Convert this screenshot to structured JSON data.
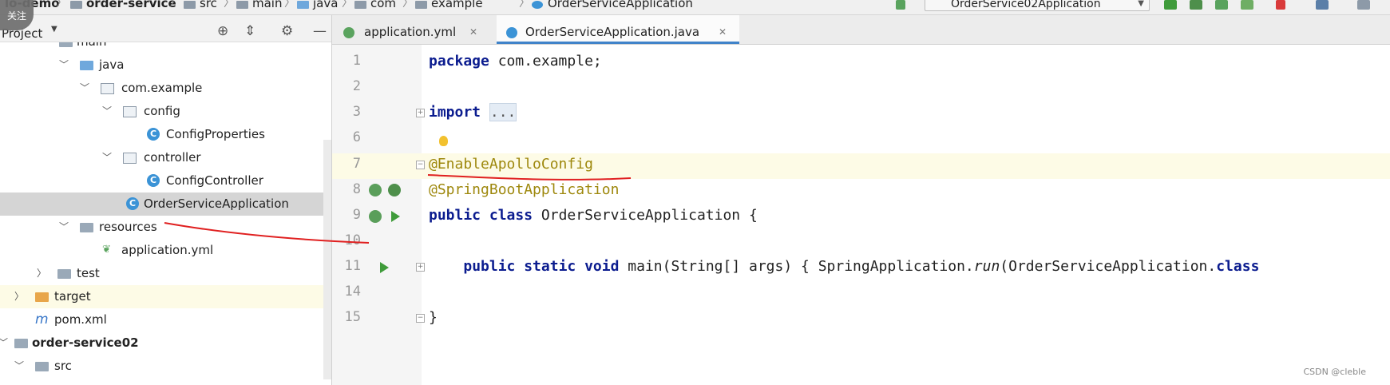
{
  "breadcrumbs": [
    {
      "label": "lo-demo",
      "bold": true
    },
    {
      "label": "order-service",
      "bold": true
    },
    {
      "label": "src",
      "bold": false
    },
    {
      "label": "main",
      "bold": false
    },
    {
      "label": "java",
      "bold": false
    },
    {
      "label": "com",
      "bold": false
    },
    {
      "label": "example",
      "bold": false
    },
    {
      "label": "OrderServiceApplication",
      "bold": false
    }
  ],
  "run_config": "OrderService02Application",
  "overlay_badge": "关注",
  "project_panel": {
    "title": "Project",
    "tree": [
      {
        "label": "main",
        "arrow": "",
        "icon": "folder"
      },
      {
        "label": "java",
        "arrow": "v",
        "icon": "folder-blue"
      },
      {
        "label": "com.example",
        "arrow": "v",
        "icon": "package"
      },
      {
        "label": "config",
        "arrow": "v",
        "icon": "package"
      },
      {
        "label": "ConfigProperties",
        "arrow": "",
        "icon": "class"
      },
      {
        "label": "controller",
        "arrow": "v",
        "icon": "package"
      },
      {
        "label": "ConfigController",
        "arrow": "",
        "icon": "class"
      },
      {
        "label": "OrderServiceApplication",
        "arrow": "",
        "icon": "class"
      },
      {
        "label": "resources",
        "arrow": "v",
        "icon": "folder"
      },
      {
        "label": "application.yml",
        "arrow": "",
        "icon": "yml"
      },
      {
        "label": "test",
        "arrow": ">",
        "icon": "folder"
      },
      {
        "label": "target",
        "arrow": ">",
        "icon": "folder-orange"
      },
      {
        "label": "pom.xml",
        "arrow": "",
        "icon": "maven"
      },
      {
        "label": "order-service02",
        "arrow": "v",
        "icon": "folder"
      },
      {
        "label": "src",
        "arrow": "v",
        "icon": "folder"
      }
    ]
  },
  "editor": {
    "tabs": [
      {
        "label": "application.yml",
        "active": false
      },
      {
        "label": "OrderServiceApplication.java",
        "active": true
      }
    ],
    "lines": [
      {
        "no": "1",
        "text": "package com.example;"
      },
      {
        "no": "2",
        "text": ""
      },
      {
        "no": "3",
        "text": "import ..."
      },
      {
        "no": "6",
        "text": ""
      },
      {
        "no": "7",
        "text": "@EnableApolloConfig"
      },
      {
        "no": "8",
        "text": "@SpringBootApplication"
      },
      {
        "no": "9",
        "text": "public class OrderServiceApplication {"
      },
      {
        "no": "10",
        "text": ""
      },
      {
        "no": "11",
        "text": "    public static void main(String[] args) { SpringApplication.run(OrderServiceApplication.class"
      },
      {
        "no": "14",
        "text": ""
      },
      {
        "no": "15",
        "text": "}"
      }
    ]
  },
  "watermark": "CSDN @cleble",
  "colors": {
    "keyword": "#0b1c8f",
    "annotation": "#9e880d",
    "selection": "#d5d5d5",
    "current_line": "#fdfbe6",
    "tab_active_underline": "#4083c9",
    "red_ink": "#e02020"
  }
}
